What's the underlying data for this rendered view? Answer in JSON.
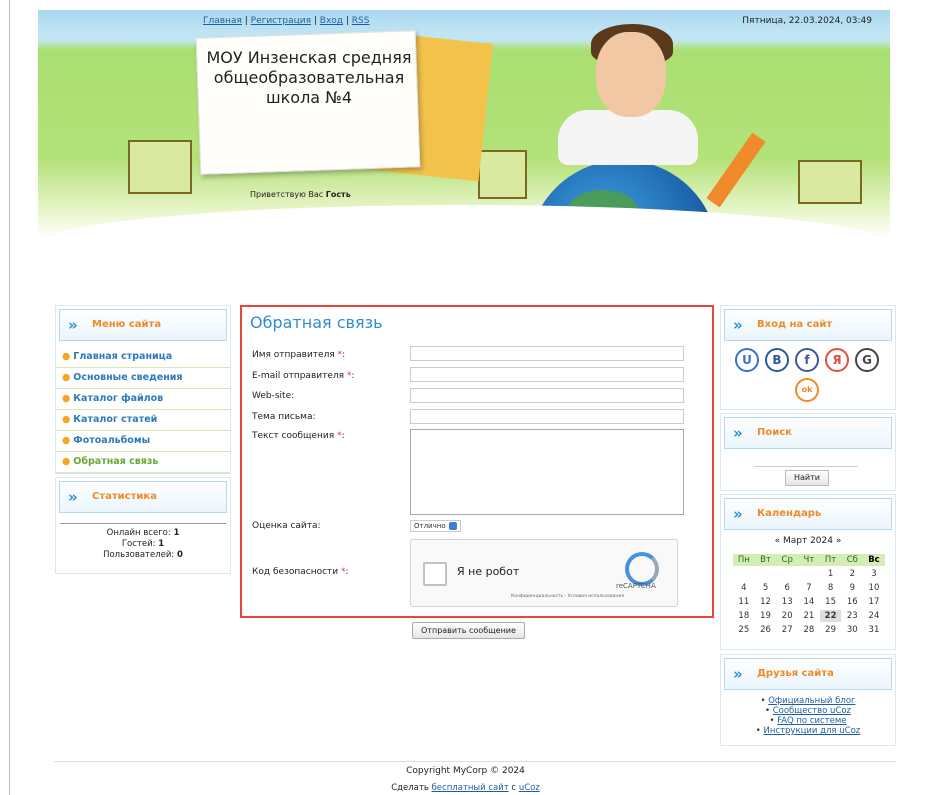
{
  "header": {
    "links": [
      "Главная",
      "Регистрация",
      "Вход",
      "RSS"
    ],
    "datetime": "Пятница, 22.03.2024, 03:49",
    "site_title": "МОУ Инзенская средняя общеобразовательная школа №4",
    "greeting_prefix": "Приветствую Вас",
    "greeting_user": "Гость"
  },
  "menu": {
    "title": "Меню сайта",
    "items": [
      "Главная страница",
      "Основные сведения",
      "Каталог файлов",
      "Каталог статей",
      "Фотоальбомы",
      "Обратная связь"
    ],
    "active": "Обратная связь"
  },
  "stats": {
    "title": "Статистика",
    "online_label": "Онлайн всего:",
    "online_value": "1",
    "guests_label": "Гостей:",
    "guests_value": "1",
    "users_label": "Пользователей:",
    "users_value": "0"
  },
  "form": {
    "title": "Обратная связь",
    "fields": {
      "sender_name": "Имя отправителя",
      "sender_email": "E-mail отправителя",
      "website": "Web-site:",
      "subject": "Тема письма:",
      "message": "Текст сообщения",
      "rating": "Оценка сайта:",
      "security": "Код безопасности"
    },
    "required_mark": "*",
    "rating_value": "Отлично",
    "captcha": {
      "label": "Я не робот",
      "brand": "reCAPTCHA",
      "terms": "Конфиденциальность - Условия использования"
    },
    "submit_label": "Отправить сообщение"
  },
  "login": {
    "title": "Вход на сайт",
    "providers": [
      "U",
      "B",
      "f",
      "Я",
      "G",
      "ok"
    ],
    "icons": [
      "ucoz-icon",
      "vk-icon",
      "facebook-icon",
      "yandex-icon",
      "google-icon",
      "odnoklassniki-icon"
    ]
  },
  "search": {
    "title": "Поиск",
    "button": "Найти"
  },
  "calendar": {
    "title": "Календарь",
    "month": "Март 2024",
    "prev": "«",
    "next": "»",
    "weekdays": [
      "Пн",
      "Вт",
      "Ср",
      "Чт",
      "Пт",
      "Сб",
      "Вс"
    ],
    "weeks": [
      [
        "",
        "",
        "",
        "",
        "1",
        "2",
        "3"
      ],
      [
        "4",
        "5",
        "6",
        "7",
        "8",
        "9",
        "10"
      ],
      [
        "11",
        "12",
        "13",
        "14",
        "15",
        "16",
        "17"
      ],
      [
        "18",
        "19",
        "20",
        "21",
        "22",
        "23",
        "24"
      ],
      [
        "25",
        "26",
        "27",
        "28",
        "29",
        "30",
        "31"
      ]
    ],
    "today": "22"
  },
  "friends": {
    "title": "Друзья сайта",
    "links": [
      "Официальный блог",
      "Сообщество uCoz",
      "FAQ по системе",
      "Инструкции для uCoz"
    ]
  },
  "footer": {
    "copyright": "Copyright MyCorp © 2024",
    "made_prefix": "Сделать",
    "made_link": "бесплатный сайт",
    "made_middle": "с",
    "made_brand": "uCoz"
  },
  "colors": {
    "accent": "#2d8ed2",
    "orange": "#f08a24",
    "form_border": "#e8463a"
  }
}
